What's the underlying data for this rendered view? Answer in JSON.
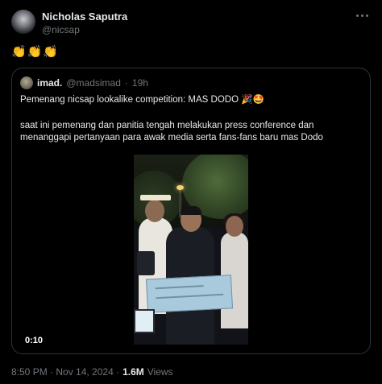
{
  "post": {
    "author_name": "Nicholas Saputra",
    "author_handle": "@nicsap",
    "text": "👏👏👏"
  },
  "quote": {
    "author_name": "imad.",
    "author_handle": "@madsimad",
    "separator": "·",
    "time": "19h",
    "text_line1": "Pemenang nicsap lookalike competition: MAS DODO 🎉🤩",
    "text_line2": "saat ini pemenang dan panitia tengah melakukan press conference dan menanggapi pertanyaan para awak media serta fans-fans baru mas Dodo",
    "video_duration": "0:10"
  },
  "footer": {
    "timestamp": "8:50 PM · Nov 14, 2024 ·",
    "views_count": "1.6M",
    "views_label": "Views"
  }
}
